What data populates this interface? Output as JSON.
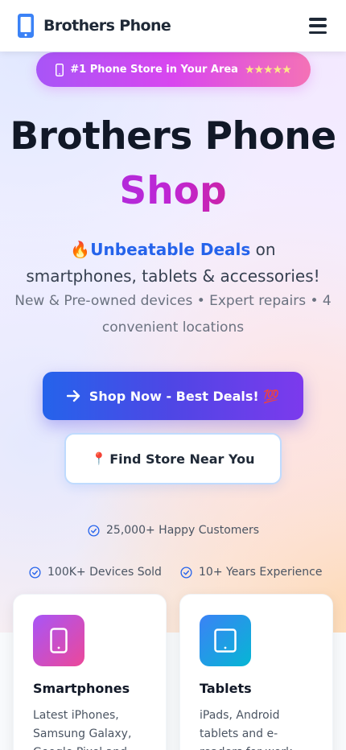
{
  "header": {
    "brand_name": "Brothers Phone",
    "brand_icon": "smartphone-icon",
    "menu_icon": "hamburger-menu-icon"
  },
  "hero": {
    "badge_text": "#1 Phone Store in Your Area",
    "badge_stars": "★★★★★",
    "title_line1": "Brothers Phone",
    "title_line2": "Shop",
    "deal_emoji": "🔥",
    "deal_highlight": "Unbeatable Deals",
    "deal_rest": " on smartphones, tablets & accessories!",
    "subtitle": "New & Pre-owned devices • Expert repairs • 4 convenient locations",
    "primary_cta": "Shop Now - Best Deals! 💯",
    "secondary_cta": "Find Store Near You",
    "secondary_cta_emoji": "📍"
  },
  "stats": [
    {
      "label": "25,000+ Happy Customers"
    },
    {
      "label": "100K+ Devices Sold"
    },
    {
      "label": "10+ Years Experience"
    }
  ],
  "categories": [
    {
      "title": "Smartphones",
      "description": "Latest iPhones, Samsung Galaxy, Google Pixel and",
      "icon": "smartphone-icon"
    },
    {
      "title": "Tablets",
      "description": "iPads, Android tablets and e-readers for work",
      "icon": "tablet-icon"
    }
  ],
  "colors": {
    "accent_blue": "#2563eb",
    "accent_purple": "#7c3aed",
    "accent_pink": "#d946ef",
    "text_dark": "#111827"
  }
}
